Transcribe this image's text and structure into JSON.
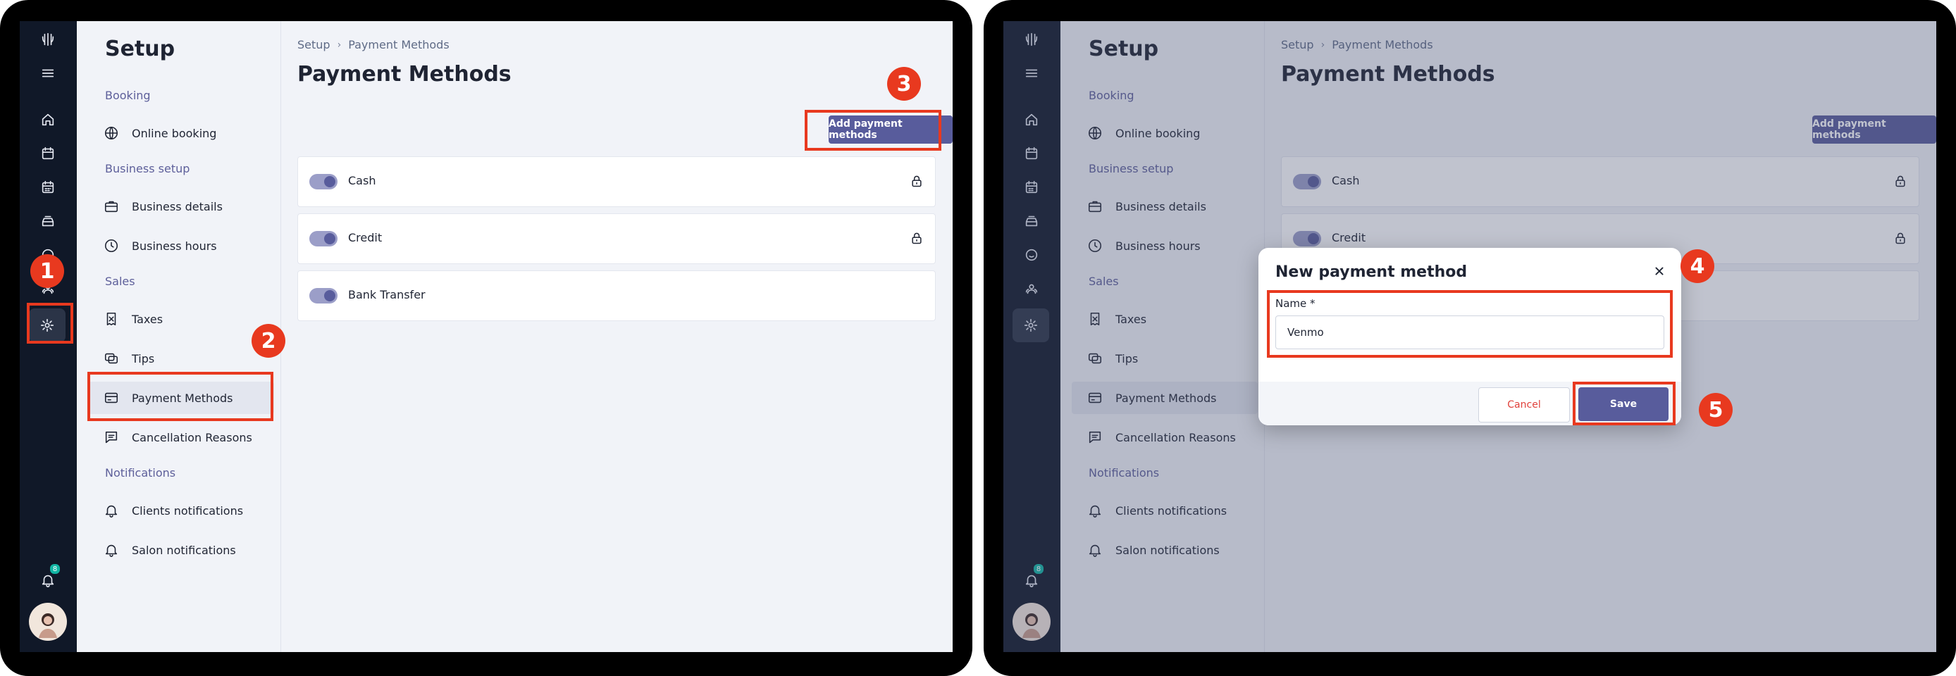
{
  "setup_title": "Setup",
  "sections": {
    "booking": "Booking",
    "business_setup": "Business setup",
    "sales": "Sales",
    "notifications": "Notifications"
  },
  "menu": [
    {
      "label": "Online booking",
      "icon": "globe-icon"
    },
    {
      "label": "Business details",
      "icon": "briefcase-icon"
    },
    {
      "label": "Business hours",
      "icon": "clock-icon"
    },
    {
      "label": "Taxes",
      "icon": "receipt-icon"
    },
    {
      "label": "Tips",
      "icon": "coins-icon"
    },
    {
      "label": "Payment Methods",
      "icon": "credit-card-icon"
    },
    {
      "label": "Cancellation Reasons",
      "icon": "message-icon"
    },
    {
      "label": "Clients notifications",
      "icon": "bell-icon"
    },
    {
      "label": "Salon notifications",
      "icon": "bell-icon"
    }
  ],
  "breadcrumb": {
    "root": "Setup",
    "current": "Payment Methods"
  },
  "page_title": "Payment Methods",
  "add_button": "Add payment methods",
  "payment_methods": [
    {
      "name": "Cash",
      "enabled": true,
      "locked": true
    },
    {
      "name": "Credit",
      "enabled": true,
      "locked": true
    },
    {
      "name": "Bank Transfer",
      "enabled": true,
      "locked": false
    }
  ],
  "notification_count": "8",
  "modal": {
    "title": "New payment method",
    "field_label": "Name *",
    "field_value": "Venmo",
    "cancel": "Cancel",
    "save": "Save"
  },
  "steps": [
    "1",
    "2",
    "3",
    "4",
    "5"
  ],
  "colors": {
    "accent": "#585c9c",
    "highlight": "#e8391f",
    "rail": "#101828",
    "badge": "#12b5a4"
  }
}
